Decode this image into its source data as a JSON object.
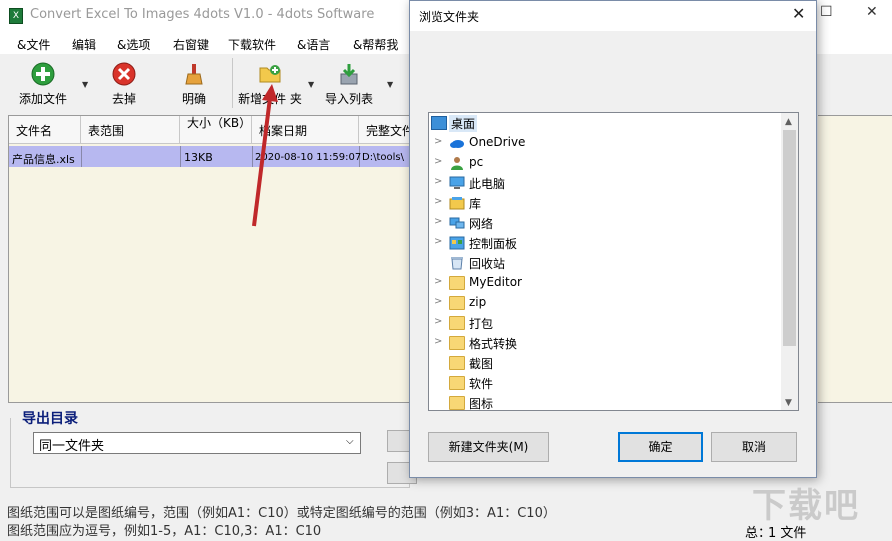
{
  "window": {
    "title": "Convert Excel To Images 4dots V1.0 - 4dots Software",
    "controls": [
      "☐",
      "✕"
    ]
  },
  "menu": [
    "&文件",
    "编辑",
    "&选项",
    "右窗键",
    "下载软件",
    "&语言",
    "&帮帮我"
  ],
  "toolbar": {
    "add_file": "添加文件",
    "remove": "去掉",
    "clear": "明确",
    "new_folder": "新增文件 夹",
    "import_list": "导入列表"
  },
  "table": {
    "columns": [
      "文件名",
      "表范围",
      "大小（KB）",
      "档案日期",
      "完整文件"
    ],
    "rows": [
      {
        "name": "产品信息.xls",
        "range": "",
        "size": "13KB",
        "date": "2020-08-10 11:59:07",
        "path": "D:\\tools\\"
      }
    ]
  },
  "output": {
    "label": "导出目录",
    "selected": "同一文件夹"
  },
  "hints": {
    "line1": "图纸范围可以是图纸编号，范围（例如A1：C10）或特定图纸编号的范围（例如3：A1：C10）",
    "line2": "图纸范围应为逗号，例如1-5，A1：C10,3：A1：C10"
  },
  "status": {
    "label": "总：",
    "count": "1 文件"
  },
  "dialog": {
    "title": "浏览文件夹",
    "tree": [
      {
        "label": "桌面",
        "icon": "desktop-icon",
        "expandable": false,
        "root": true
      },
      {
        "label": "OneDrive",
        "icon": "cloud-icon",
        "expandable": true
      },
      {
        "label": "pc",
        "icon": "user-icon",
        "expandable": true
      },
      {
        "label": "此电脑",
        "icon": "computer-icon",
        "expandable": true
      },
      {
        "label": "库",
        "icon": "library-icon",
        "expandable": true
      },
      {
        "label": "网络",
        "icon": "network-icon",
        "expandable": true
      },
      {
        "label": "控制面板",
        "icon": "control-panel-icon",
        "expandable": true
      },
      {
        "label": "回收站",
        "icon": "recycle-bin-icon",
        "expandable": false
      },
      {
        "label": "MyEditor",
        "icon": "folder-icon",
        "expandable": true
      },
      {
        "label": "zip",
        "icon": "folder-icon",
        "expandable": true
      },
      {
        "label": "打包",
        "icon": "folder-icon",
        "expandable": true
      },
      {
        "label": "格式转换",
        "icon": "folder-icon",
        "expandable": true
      },
      {
        "label": "截图",
        "icon": "folder-icon",
        "expandable": false
      },
      {
        "label": "软件",
        "icon": "folder-icon",
        "expandable": false
      },
      {
        "label": "图标",
        "icon": "folder-icon",
        "expandable": false
      }
    ],
    "new_folder_button": "新建文件夹(M)",
    "ok_button": "确定",
    "cancel_button": "取消"
  },
  "watermark": "下载吧",
  "colors": {
    "selection": "#b7b8f0",
    "accent": "#0078d7",
    "table_bg": "#f7f4e4",
    "output_label": "#0b1e7a"
  }
}
